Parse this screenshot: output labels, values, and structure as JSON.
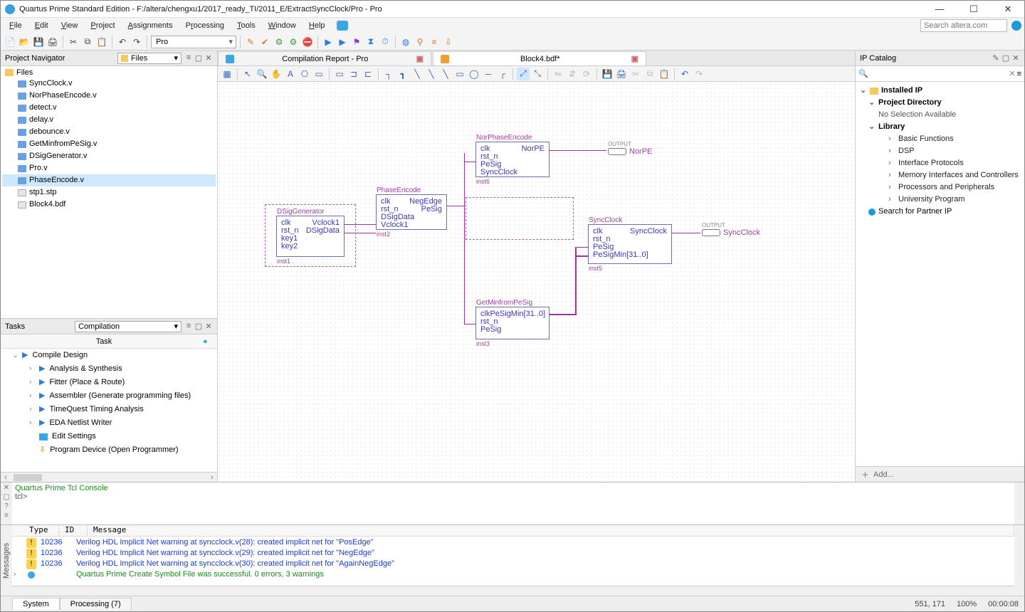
{
  "titlebar": {
    "title": "Quartus Prime Standard Edition - F:/altera/chengxu1/2017_ready_TI/2011_E/ExtractSyncClock/Pro - Pro"
  },
  "menubar": {
    "items": [
      "File",
      "Edit",
      "View",
      "Project",
      "Assignments",
      "Processing",
      "Tools",
      "Window",
      "Help"
    ],
    "search_placeholder": "Search altera.com"
  },
  "toolbar": {
    "project_combo": "Pro"
  },
  "left": {
    "nav_title": "Project Navigator",
    "nav_combo": "Files",
    "files_root": "Files",
    "files": [
      "SyncClock.v",
      "NorPhaseEncode.v",
      "detect.v",
      "delay.v",
      "debounce.v",
      "GetMinfromPeSig.v",
      "DSigGenerator.v",
      "Pro.v",
      "PhaseEncode.v",
      "stp1.stp",
      "Block4.bdf"
    ],
    "selected_file_index": 8,
    "tasks_title": "Tasks",
    "tasks_combo": "Compilation",
    "tasks_header": "Task",
    "tasks": [
      "Compile Design",
      "Analysis & Synthesis",
      "Fitter (Place & Route)",
      "Assembler (Generate programming files)",
      "TimeQuest Timing Analysis",
      "EDA Netlist Writer",
      "Edit Settings",
      "Program Device (Open Programmer)"
    ]
  },
  "tabs": {
    "tab1": "Compilation Report - Pro",
    "tab2": "Block4.bdf*"
  },
  "blocks": {
    "dsig": {
      "title": "DSigGenerator",
      "inst": "inst1",
      "left": [
        "clk",
        "rst_n",
        "key1",
        "key2"
      ],
      "right": [
        "Vclock1",
        "DSigData"
      ]
    },
    "phase": {
      "title": "PhaseEncode",
      "inst": "inst2",
      "left": [
        "clk",
        "rst_n",
        "DSigData",
        "Vclock1"
      ],
      "right": [
        "NegEdge",
        "PeSig"
      ]
    },
    "nor": {
      "title": "NorPhaseEncode",
      "inst": "inst6",
      "left": [
        "clk",
        "rst_n",
        "PeSig",
        "SyncClock"
      ],
      "right": [
        "NorPE"
      ]
    },
    "getmin": {
      "title": "GetMinfromPeSig",
      "inst": "inst3",
      "left": [
        "clk",
        "rst_n",
        "PeSig"
      ],
      "right": [
        "PeSigMin[31..0]"
      ]
    },
    "sync": {
      "title": "SyncClock",
      "inst": "inst5",
      "left": [
        "clk",
        "rst_n",
        "PeSig",
        "PeSigMin[31..0]"
      ],
      "right": [
        "SyncClock"
      ]
    },
    "out1_label": "NorPE",
    "out1_tag": "OUTPUT",
    "out2_label": "SyncClock",
    "out2_tag": "OUTPUT"
  },
  "ip": {
    "title": "IP Catalog",
    "root": "Installed IP",
    "projdir": "Project Directory",
    "projdir_empty": "No Selection Available",
    "library": "Library",
    "lib_items": [
      "Basic Functions",
      "DSP",
      "Interface Protocols",
      "Memory Interfaces and Controllers",
      "Processors and Peripherals",
      "University Program"
    ],
    "search_partner": "Search for Partner IP",
    "add_label": "Add..."
  },
  "console": {
    "title": "Quartus Prime Tcl Console",
    "prompt": "tcl>"
  },
  "messages": {
    "side_label": "Messages",
    "cols": [
      "Type",
      "ID",
      "Message"
    ],
    "rows": [
      {
        "type": "warn",
        "id": "10236",
        "text": "Verilog HDL Implicit Net warning at syncclock.v(28): created implicit net for \"PosEdge\""
      },
      {
        "type": "warn",
        "id": "10236",
        "text": "Verilog HDL Implicit Net warning at syncclock.v(29): created implicit net for \"NegEdge\""
      },
      {
        "type": "warn",
        "id": "10236",
        "text": "Verilog HDL Implicit Net warning at syncclock.v(30): created implicit net for \"AgainNegEdge\""
      },
      {
        "type": "info",
        "id": "",
        "text": "Quartus Prime Create Symbol File was successful. 0 errors, 3 warnings"
      }
    ]
  },
  "bottom": {
    "tab1": "System",
    "tab2": "Processing (7)",
    "status_coord": "551, 171",
    "status_zoom": "100%",
    "status_time": "00:00:08"
  }
}
